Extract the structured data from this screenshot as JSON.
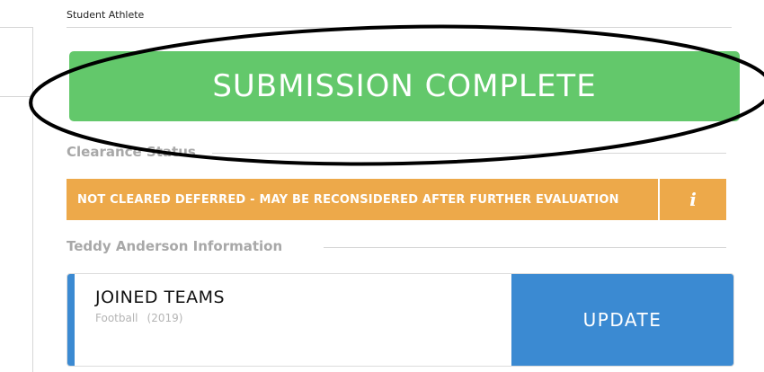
{
  "header": {
    "label": "Student Athlete"
  },
  "banner": {
    "text": "SUBMISSION COMPLETE"
  },
  "clearance": {
    "heading": "Clearance Status",
    "status_text": "NOT CLEARED DEFERRED - MAY BE RECONSIDERED AFTER FURTHER EVALUATION",
    "info_glyph": "i"
  },
  "athlete_info": {
    "heading": "Teddy Anderson Information"
  },
  "teams_card": {
    "title": "JOINED TEAMS",
    "sport": "Football",
    "year": "(2019)",
    "update_label": "UPDATE"
  },
  "colors": {
    "success_green": "#63c86b",
    "warning_orange": "#eda94a",
    "primary_blue": "#3b8ad2"
  }
}
